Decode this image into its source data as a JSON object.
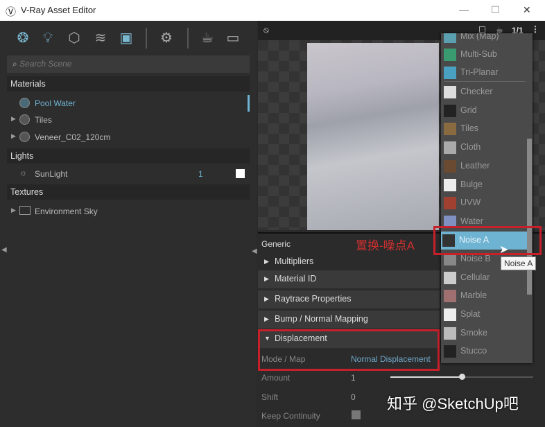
{
  "window": {
    "title": "V-Ray Asset Editor",
    "minimize": "—",
    "maximize": "☐",
    "close": "✕"
  },
  "toolbar": {
    "icons": [
      "materials-icon",
      "lights-icon",
      "geometry-icon",
      "render-elements-icon",
      "textures-icon",
      "settings-icon",
      "render-interactive-icon",
      "frame-buffer-icon"
    ]
  },
  "search": {
    "placeholder": "Search Scene"
  },
  "tree": {
    "materials_label": "Materials",
    "materials": [
      {
        "name": "Pool Water",
        "selected": true
      },
      {
        "name": "Tiles"
      },
      {
        "name": "Veneer_C02_120cm"
      }
    ],
    "lights_label": "Lights",
    "lights": [
      {
        "name": "SunLight",
        "count": "1"
      }
    ],
    "textures_label": "Textures",
    "textures": [
      {
        "name": "Environment Sky"
      }
    ]
  },
  "preview": {
    "page": "1/1"
  },
  "properties": {
    "generic": "Generic",
    "sections": [
      "Multipliers",
      "Material ID",
      "Raytrace Properties",
      "Bump / Normal Mapping"
    ],
    "displacement": "Displacement",
    "rows": [
      {
        "label": "Mode / Map",
        "value": "Normal Displacement"
      },
      {
        "label": "Amount",
        "value": "1"
      },
      {
        "label": "Shift",
        "value": "0"
      },
      {
        "label": "Keep Continuity",
        "value": ""
      }
    ],
    "amount_slider_fraction": 0.5
  },
  "menu": {
    "items": [
      {
        "label": "Mix (Map)",
        "color": "#5aa0b0"
      },
      {
        "label": "Multi-Sub",
        "color": "#3a9a70"
      },
      {
        "label": "Tri-Planar",
        "color": "#4aa0c0"
      },
      {
        "label": "Checker",
        "color": "#ddd"
      },
      {
        "label": "Grid",
        "color": "#222"
      },
      {
        "label": "Tiles",
        "color": "#8a6a40"
      },
      {
        "label": "Cloth",
        "color": "#aaa"
      },
      {
        "label": "Leather",
        "color": "#6a4a30"
      },
      {
        "label": "Bulge",
        "color": "#eee"
      },
      {
        "label": "UVW",
        "color": "#a04030"
      },
      {
        "label": "Water",
        "color": "#8090c0"
      },
      {
        "label": "Noise A",
        "color": "#333",
        "highlighted": true
      },
      {
        "label": "Noise B",
        "color": "#888"
      },
      {
        "label": "Cellular",
        "color": "#ccc"
      },
      {
        "label": "Marble",
        "color": "#a07070"
      },
      {
        "label": "Splat",
        "color": "#eee"
      },
      {
        "label": "Smoke",
        "color": "#bbb"
      },
      {
        "label": "Stucco",
        "color": "#222"
      }
    ]
  },
  "tooltip": "Noise A",
  "annotation": "置换-噪点A",
  "watermark": "知乎 @SketchUp吧"
}
